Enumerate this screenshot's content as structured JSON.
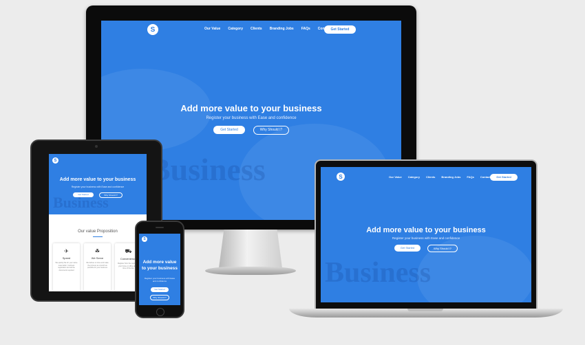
{
  "site": {
    "logo_text": "S",
    "nav": [
      "Our Value",
      "Category",
      "Clients",
      "Branding Jobs",
      "FAQs",
      "Contact"
    ],
    "nav_laptop": [
      "Our Value",
      "Category",
      "Clients",
      "Branding Jobs",
      "FAQs",
      "Contact"
    ],
    "nav_button": "Get Started",
    "hero_title": "Add more value to your business",
    "hero_subtitle": "Register your business with Ease and confidence",
    "cta_primary": "Get Started",
    "cta_secondary": "Why Should I?",
    "bg_word": "Business"
  },
  "tablet": {
    "hero_title": "Add more value to your business",
    "hero_subtitle": "Register your business with Ease and confidence",
    "cta_primary": "Get Started",
    "cta_secondary": "Why Should I?",
    "section_title": "Our value Proposition",
    "cards": [
      {
        "icon": "rocket-icon",
        "title": "Speed",
        "text": "We quickly file for your name reservation, business registration and all the documents required"
      },
      {
        "icon": "handshake-icon",
        "title": "We Serve",
        "text": "We deliver on time and make the process as smooth as possible for your business"
      },
      {
        "icon": "cart-icon",
        "title": "Convenience",
        "text": "Register from the comfort of your home or office at any time of the day"
      }
    ]
  },
  "phone": {
    "hero_title": "Add more value to your business",
    "hero_subtitle": "Register your business with Ease and confidence",
    "cta_primary": "Get Started",
    "cta_secondary": "Why Should I?"
  },
  "colors": {
    "brand": "#2f7fe3",
    "bezel": "#111111",
    "background": "#ececec"
  }
}
